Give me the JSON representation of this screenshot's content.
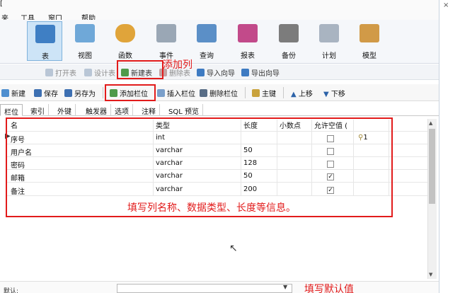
{
  "menu": {
    "edge_glyph": "[",
    "items": [
      "夹",
      "工具",
      "窗口",
      "帮助"
    ]
  },
  "big_toolbar": [
    {
      "label": "表",
      "icon": "table-icon",
      "active": true
    },
    {
      "label": "视图",
      "icon": "view-icon"
    },
    {
      "label": "函数",
      "icon": "function-icon"
    },
    {
      "label": "事件",
      "icon": "event-icon"
    },
    {
      "label": "查询",
      "icon": "query-icon"
    },
    {
      "label": "报表",
      "icon": "report-icon"
    },
    {
      "label": "备份",
      "icon": "backup-icon"
    },
    {
      "label": "计划",
      "icon": "schedule-icon"
    },
    {
      "label": "模型",
      "icon": "model-icon"
    }
  ],
  "object_toolbar": {
    "open_table": "打开表",
    "design_table": "设计表",
    "new_table": "新建表",
    "delete_table": "删除表",
    "import_wizard": "导入向导",
    "export_wizard": "导出向导"
  },
  "design_toolbar": {
    "new": "新建",
    "save": "保存",
    "save_as": "另存为",
    "add_field": "添加栏位",
    "insert_field": "插入栏位",
    "delete_field": "删除栏位",
    "primary_key": "主键",
    "move_up": "上移",
    "move_down": "下移"
  },
  "tabs": [
    "栏位",
    "索引",
    "外键",
    "触发器",
    "选项",
    "注释",
    "SQL 预览"
  ],
  "grid": {
    "headers": [
      "名",
      "类型",
      "长度",
      "小数点",
      "允许空值 (",
      ""
    ],
    "rows": [
      {
        "name": "序号",
        "type": "int",
        "length": "",
        "decimals": "",
        "nullable": false,
        "key": "1"
      },
      {
        "name": "用户名",
        "type": "varchar",
        "length": "50",
        "decimals": "",
        "nullable": false,
        "key": ""
      },
      {
        "name": "密码",
        "type": "varchar",
        "length": "128",
        "decimals": "",
        "nullable": false,
        "key": ""
      },
      {
        "name": "邮箱",
        "type": "varchar",
        "length": "50",
        "decimals": "",
        "nullable": true,
        "key": ""
      },
      {
        "name": "备注",
        "type": "varchar",
        "length": "200",
        "decimals": "",
        "nullable": true,
        "key": ""
      }
    ]
  },
  "annotations": {
    "add_column": "添加列",
    "fill_info": "填写列名称、数据类型、长度等信息。",
    "fill_default": "填写默认值"
  },
  "bottom": {
    "default_label": "默认:"
  },
  "colors": {
    "annotation_red": "#e21b1b",
    "active_tab_blue": "#cde4f7"
  }
}
